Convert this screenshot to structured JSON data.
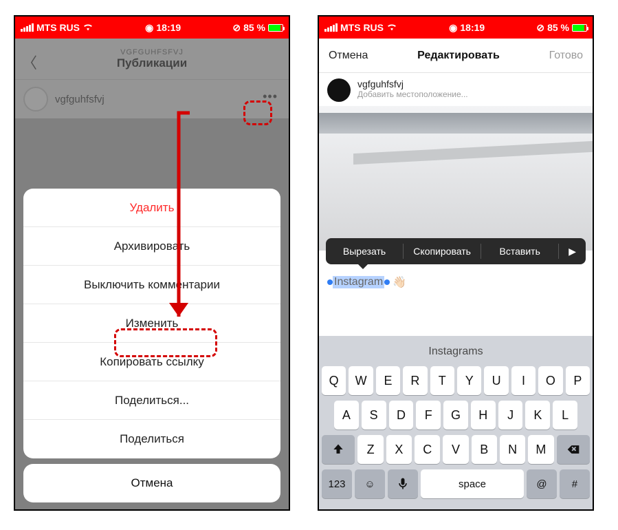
{
  "statusbar": {
    "carrier": "MTS RUS",
    "time": "18:19",
    "battery": "85 %"
  },
  "left": {
    "header": {
      "subtitle": "VGFGUHFSFVJ",
      "title": "Публикации"
    },
    "post": {
      "username": "vgfguhfsfvj"
    },
    "sheet": {
      "delete": "Удалить",
      "archive": "Архивировать",
      "mute_comments": "Выключить комментарии",
      "edit": "Изменить",
      "copy_link": "Копировать ссылку",
      "share1": "Поделиться...",
      "share2": "Поделиться",
      "cancel": "Отмена"
    }
  },
  "right": {
    "nav": {
      "cancel": "Отмена",
      "title": "Редактировать",
      "done": "Готово"
    },
    "edit_header": {
      "username": "vgfguhfsfvj",
      "add_location": "Добавить местоположение..."
    },
    "ctx": {
      "cut": "Вырезать",
      "copy": "Скопировать",
      "paste": "Вставить"
    },
    "caption_word": "Instagram",
    "caption_emoji": "👋🏻"
  },
  "keyboard": {
    "suggestion": "Instagrams",
    "row1": [
      "Q",
      "W",
      "E",
      "R",
      "T",
      "Y",
      "U",
      "I",
      "O",
      "P"
    ],
    "row2": [
      "A",
      "S",
      "D",
      "F",
      "G",
      "H",
      "J",
      "K",
      "L"
    ],
    "row3": [
      "Z",
      "X",
      "C",
      "V",
      "B",
      "N",
      "M"
    ],
    "numkey": "123",
    "space": "space",
    "atkey": "@",
    "hashkey": "#"
  }
}
